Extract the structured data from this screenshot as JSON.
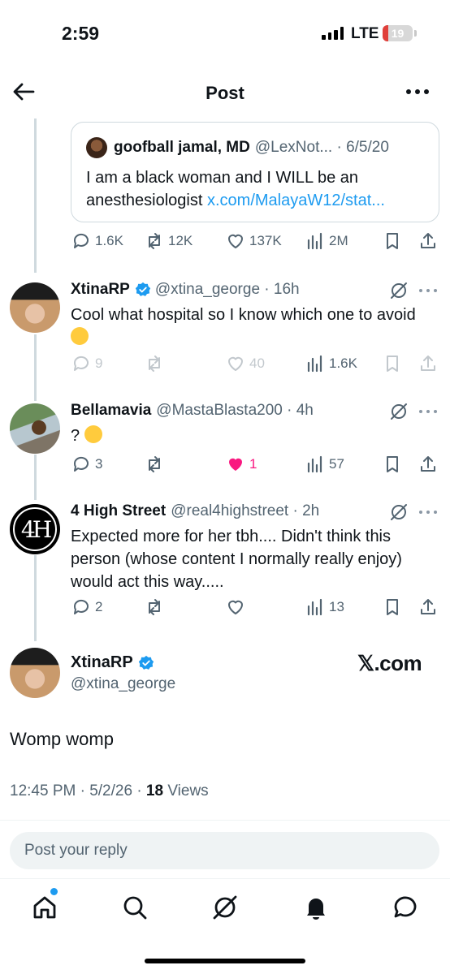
{
  "status_bar": {
    "time": "2:59",
    "network": "LTE",
    "battery": "19",
    "battery_level": 0.19
  },
  "header": {
    "title": "Post",
    "back_icon": "arrow-left-icon",
    "more_icon": "more-horizontal-icon"
  },
  "quote": {
    "name": "goofball jamal, MD",
    "meta": "@LexNot... · 6/5/20",
    "text": "I am a black woman and I WILL be an anesthesiologist ",
    "link": "x.com/MalayaW12/stat..."
  },
  "parent_actions": {
    "replies": "1.6K",
    "reposts": "12K",
    "likes": "137K",
    "views": "2M"
  },
  "replies": [
    {
      "name": "XtinaRP",
      "handle": "@xtina_george · 16h",
      "verified": true,
      "text": "Cool what hospital so I know which one to avoid ",
      "replies": "9",
      "reposts": "",
      "likes": "40",
      "views": "1.6K"
    },
    {
      "name": "Bellamavia",
      "handle": "@MastaBlasta200 · 4h",
      "verified": false,
      "text": "? ",
      "replies": "3",
      "reposts": "",
      "likes": "1",
      "views": "57",
      "liked": true
    },
    {
      "name": "4 High Street",
      "handle": "@real4highstreet · 2h",
      "verified": false,
      "avatar_text": "4H",
      "text": "Expected more for her tbh.... Didn't think this person (whose content I normally really enjoy) would act this way.....",
      "replies": "2",
      "reposts": "",
      "likes": "",
      "views": "13"
    }
  ],
  "main_post": {
    "name": "XtinaRP",
    "handle": "@xtina_george",
    "watermark": "𝕏.com",
    "text": "Womp womp",
    "time": "12:45 PM · 5/2/26 · ",
    "views_count": "18",
    "views_label": " Views"
  },
  "reply_box": {
    "placeholder": "Post your reply"
  },
  "tabs": [
    "home-icon",
    "search-icon",
    "grok-icon",
    "notifications-icon",
    "messages-icon"
  ],
  "colors": {
    "accent": "#1d9bf0",
    "like": "#f91880",
    "muted": "#536471"
  }
}
